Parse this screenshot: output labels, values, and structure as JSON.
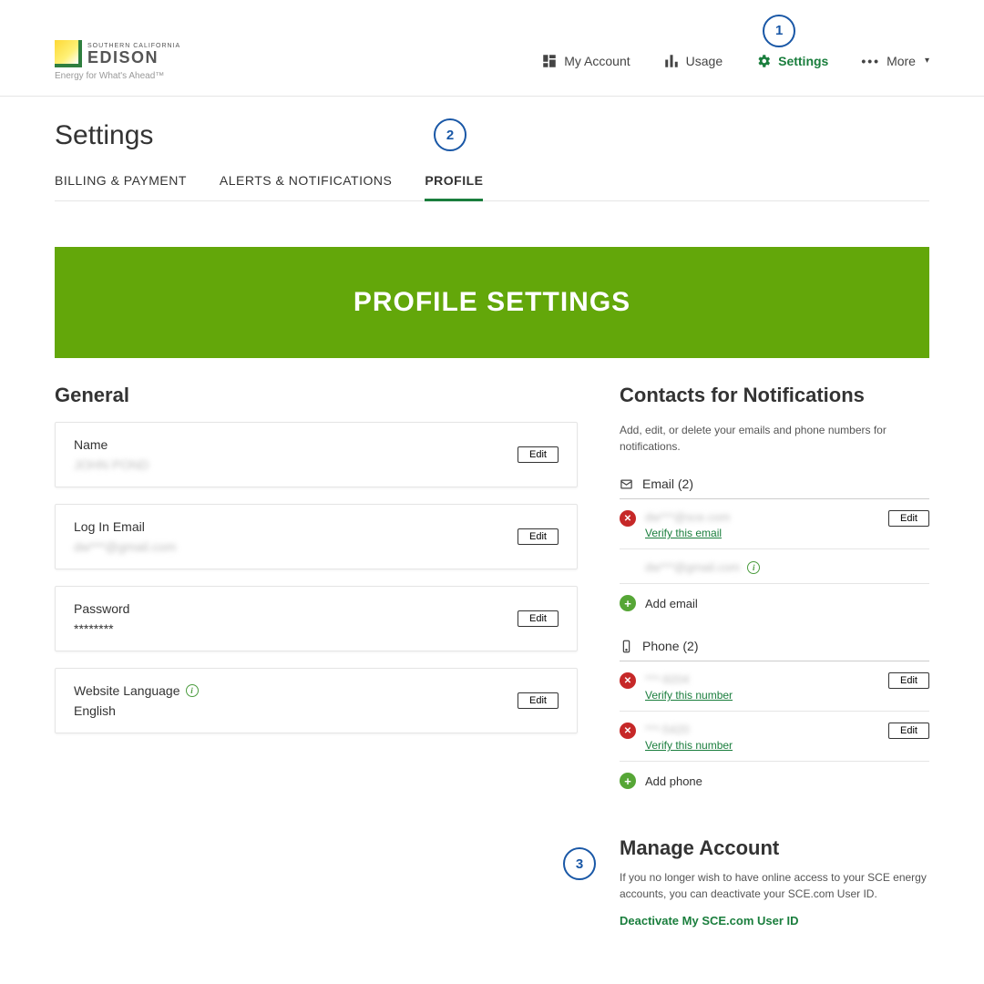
{
  "logo": {
    "small": "SOUTHERN CALIFORNIA",
    "brand": "EDISON",
    "tagline": "Energy for What's Ahead™"
  },
  "nav": {
    "my_account": "My Account",
    "usage": "Usage",
    "settings": "Settings",
    "more": "More"
  },
  "callouts": {
    "one": "1",
    "two": "2",
    "three": "3"
  },
  "page_title": "Settings",
  "tabs": {
    "billing": "BILLING & PAYMENT",
    "alerts": "ALERTS & NOTIFICATIONS",
    "profile": "PROFILE"
  },
  "banner": "PROFILE SETTINGS",
  "general": {
    "title": "General",
    "name_label": "Name",
    "name_value": "JOHN POND",
    "login_label": "Log In Email",
    "login_value": "dw***@gmail.com",
    "password_label": "Password",
    "password_value": "********",
    "language_label": "Website Language",
    "language_value": "English",
    "edit": "Edit"
  },
  "contacts": {
    "title": "Contacts for Notifications",
    "desc": "Add, edit, or delete your emails and phone numbers for notifications.",
    "email_header": "Email (2)",
    "phone_header": "Phone (2)",
    "emails": [
      {
        "value": "dw***@sce.com",
        "verify": "Verify this email",
        "editable": true
      },
      {
        "value": "dw***@gmail.com",
        "info": true
      }
    ],
    "add_email": "Add email",
    "phones": [
      {
        "value": "***-9204",
        "verify": "Verify this number",
        "editable": true
      },
      {
        "value": "***-5420",
        "verify": "Verify this number",
        "editable": true
      }
    ],
    "add_phone": "Add phone",
    "edit": "Edit"
  },
  "manage": {
    "title": "Manage Account",
    "desc": "If you no longer wish to have online access to your SCE energy accounts, you can deactivate your SCE.com User ID.",
    "link": "Deactivate My SCE.com User ID"
  }
}
